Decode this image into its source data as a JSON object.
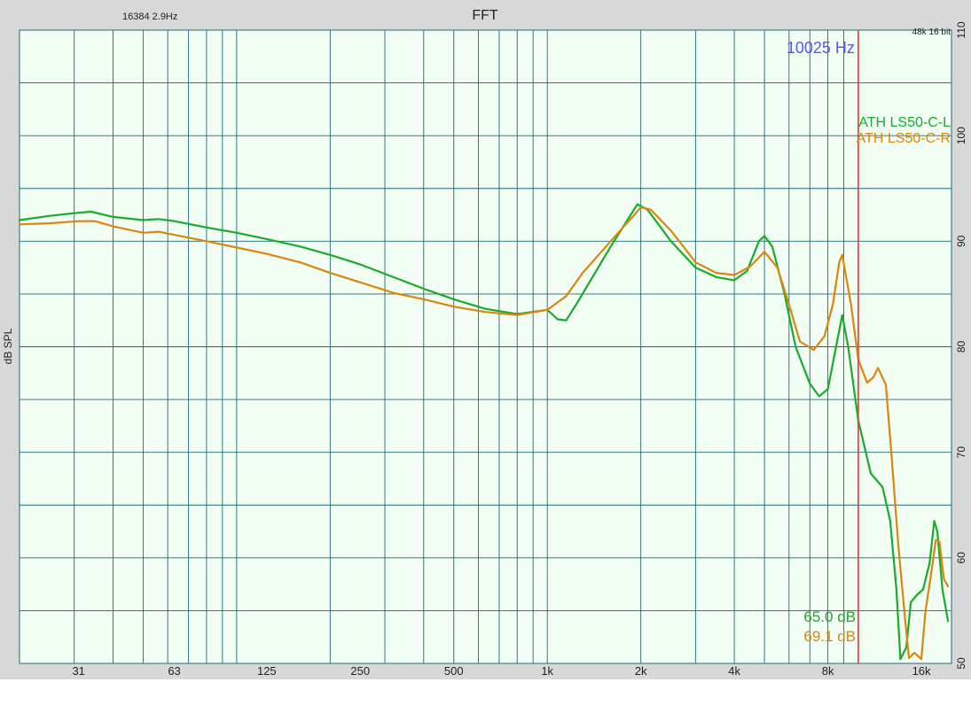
{
  "header": {
    "title": "FFT",
    "fft_info": "16384  2.9Hz",
    "format": "48k 16 bit"
  },
  "cursor": {
    "freq_label": "10025 Hz",
    "readouts": [
      "65.0 dB",
      "69.1 dB"
    ]
  },
  "colors": {
    "background": "#f2fdf4",
    "frame": "#d8d8d8",
    "grid": "#1c6b74",
    "series_l": "#1aab2c",
    "series_r": "#d9870f",
    "cursor_line": "#e8443a",
    "cursor_text": "#5a5ae6"
  },
  "chart_data": {
    "type": "line",
    "title": "FFT",
    "xlabel": "",
    "ylabel": "dB SPL",
    "x_scale": "log",
    "xlim": [
      20,
      20000
    ],
    "ylim": [
      50,
      110
    ],
    "x_ticks": [
      {
        "value": 31,
        "label": "31"
      },
      {
        "value": 63,
        "label": "63"
      },
      {
        "value": 125,
        "label": "125"
      },
      {
        "value": 250,
        "label": "250"
      },
      {
        "value": 500,
        "label": "500"
      },
      {
        "value": 1000,
        "label": "1k"
      },
      {
        "value": 2000,
        "label": "2k"
      },
      {
        "value": 4000,
        "label": "4k"
      },
      {
        "value": 8000,
        "label": "8k"
      },
      {
        "value": 16000,
        "label": "16k"
      }
    ],
    "y_ticks": [
      {
        "value": 50,
        "label": "50"
      },
      {
        "value": 60,
        "label": "60"
      },
      {
        "value": 70,
        "label": "70"
      },
      {
        "value": 80,
        "label": "80"
      },
      {
        "value": 90,
        "label": "90"
      },
      {
        "value": 100,
        "label": "100"
      },
      {
        "value": 110,
        "label": "110"
      }
    ],
    "grid": true,
    "legend_position": "top-right",
    "cursor_x": 10025,
    "series": [
      {
        "name": "ATH LS50-C-L",
        "points": [
          [
            20,
            92.0
          ],
          [
            25,
            92.4
          ],
          [
            31,
            92.7
          ],
          [
            34,
            92.8
          ],
          [
            40,
            92.3
          ],
          [
            50,
            92.0
          ],
          [
            56,
            92.1
          ],
          [
            63,
            91.9
          ],
          [
            80,
            91.3
          ],
          [
            100,
            90.8
          ],
          [
            125,
            90.2
          ],
          [
            160,
            89.5
          ],
          [
            200,
            88.7
          ],
          [
            250,
            87.8
          ],
          [
            320,
            86.6
          ],
          [
            400,
            85.5
          ],
          [
            500,
            84.5
          ],
          [
            630,
            83.6
          ],
          [
            800,
            83.1
          ],
          [
            1000,
            83.5
          ],
          [
            1080,
            82.6
          ],
          [
            1150,
            82.5
          ],
          [
            1250,
            84.2
          ],
          [
            1600,
            89.5
          ],
          [
            1950,
            93.5
          ],
          [
            2100,
            93.0
          ],
          [
            2500,
            90.0
          ],
          [
            3000,
            87.5
          ],
          [
            3500,
            86.6
          ],
          [
            4000,
            86.3
          ],
          [
            4400,
            87.2
          ],
          [
            4800,
            90.0
          ],
          [
            5000,
            90.5
          ],
          [
            5300,
            89.5
          ],
          [
            5800,
            85.0
          ],
          [
            6300,
            80.0
          ],
          [
            7000,
            76.5
          ],
          [
            7500,
            75.3
          ],
          [
            8000,
            76.0
          ],
          [
            8500,
            80.0
          ],
          [
            8900,
            83.0
          ],
          [
            9300,
            80.0
          ],
          [
            10025,
            73.0
          ],
          [
            11000,
            68.0
          ],
          [
            12000,
            66.7
          ],
          [
            12700,
            63.5
          ],
          [
            13300,
            57.0
          ],
          [
            13700,
            50.4
          ],
          [
            14300,
            51.5
          ],
          [
            14800,
            55.8
          ],
          [
            15500,
            56.5
          ],
          [
            16200,
            57.0
          ],
          [
            17000,
            59.5
          ],
          [
            17600,
            63.5
          ],
          [
            18000,
            62.5
          ],
          [
            18700,
            57.0
          ],
          [
            19500,
            54.0
          ]
        ]
      },
      {
        "name": "ATH LS50-C-R",
        "points": [
          [
            20,
            91.6
          ],
          [
            25,
            91.7
          ],
          [
            31,
            91.9
          ],
          [
            35,
            91.9
          ],
          [
            40,
            91.4
          ],
          [
            50,
            90.8
          ],
          [
            56,
            90.9
          ],
          [
            63,
            90.6
          ],
          [
            80,
            90.0
          ],
          [
            100,
            89.4
          ],
          [
            125,
            88.8
          ],
          [
            160,
            88.0
          ],
          [
            200,
            87.0
          ],
          [
            250,
            86.1
          ],
          [
            320,
            85.1
          ],
          [
            400,
            84.5
          ],
          [
            500,
            83.8
          ],
          [
            630,
            83.3
          ],
          [
            800,
            83.0
          ],
          [
            1000,
            83.5
          ],
          [
            1150,
            84.8
          ],
          [
            1300,
            87.0
          ],
          [
            1600,
            90.0
          ],
          [
            2000,
            93.2
          ],
          [
            2150,
            93.0
          ],
          [
            2500,
            91.0
          ],
          [
            3000,
            88.0
          ],
          [
            3500,
            87.0
          ],
          [
            4000,
            86.8
          ],
          [
            4500,
            87.6
          ],
          [
            5000,
            89.0
          ],
          [
            5500,
            87.5
          ],
          [
            6000,
            84.0
          ],
          [
            6500,
            80.5
          ],
          [
            7200,
            79.7
          ],
          [
            7800,
            81.0
          ],
          [
            8300,
            84.0
          ],
          [
            8700,
            88.0
          ],
          [
            8900,
            88.7
          ],
          [
            9500,
            84.0
          ],
          [
            10025,
            78.8
          ],
          [
            10700,
            76.6
          ],
          [
            11200,
            77.1
          ],
          [
            11600,
            78.0
          ],
          [
            12300,
            76.4
          ],
          [
            12800,
            70.0
          ],
          [
            13500,
            61.0
          ],
          [
            14200,
            54.0
          ],
          [
            14600,
            50.5
          ],
          [
            15200,
            51.0
          ],
          [
            16000,
            50.4
          ],
          [
            16500,
            55.0
          ],
          [
            17200,
            58.5
          ],
          [
            17800,
            61.7
          ],
          [
            18300,
            61.5
          ],
          [
            18900,
            58.0
          ],
          [
            19500,
            57.3
          ]
        ]
      }
    ]
  }
}
